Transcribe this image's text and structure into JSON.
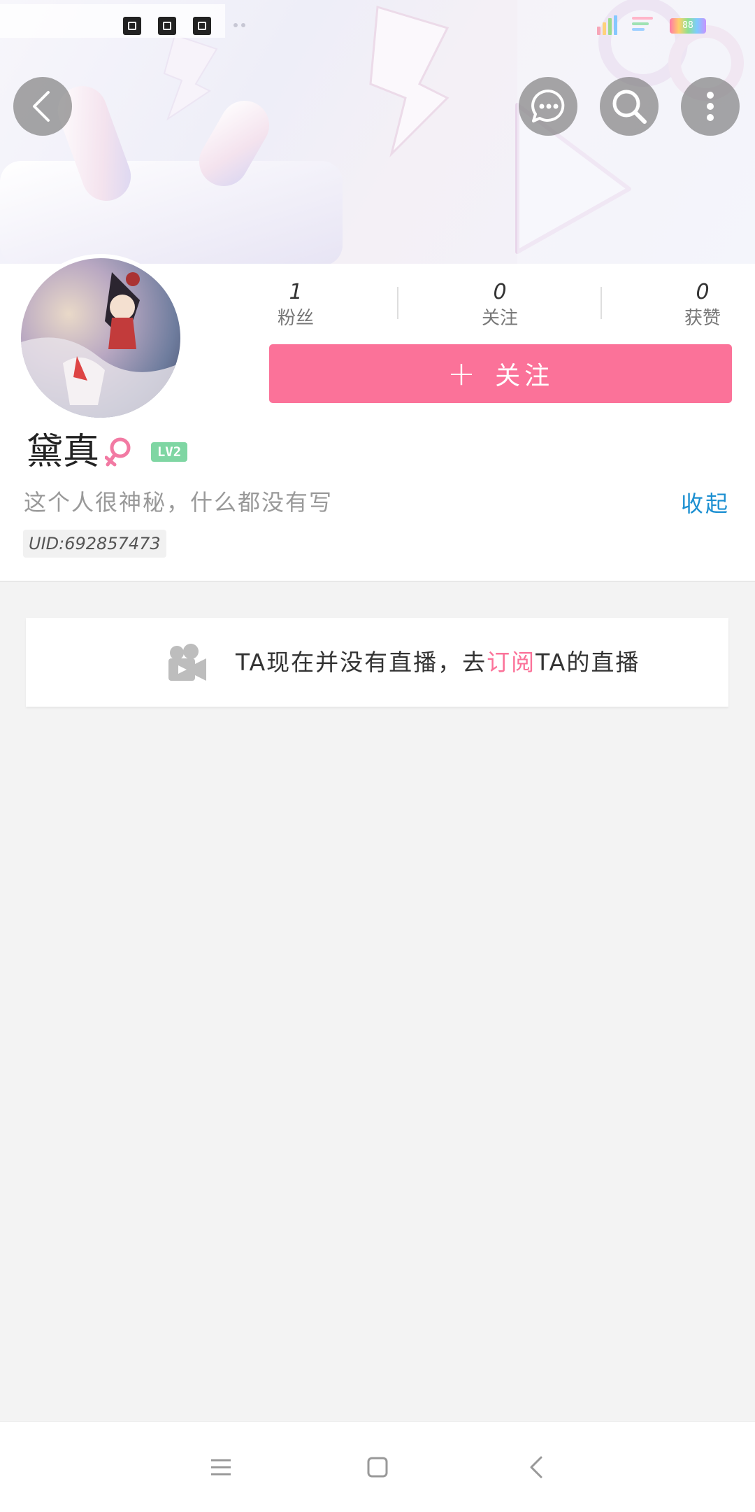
{
  "status_bar": {
    "battery_text": "88",
    "icons": [
      "app-icon-1",
      "edit-icon",
      "app-icon-3"
    ]
  },
  "header": {
    "back_icon": "chevron-left-icon",
    "actions": [
      "message-icon",
      "search-icon",
      "more-vertical-icon"
    ]
  },
  "profile": {
    "username": "黛真",
    "gender": "female",
    "level": "LV2",
    "signature": "这个人很神秘，什么都没有写",
    "collapse_label": "收起",
    "uid": "UID:692857473",
    "stats": [
      {
        "value": "1",
        "label": "粉丝"
      },
      {
        "value": "0",
        "label": "关注"
      },
      {
        "value": "0",
        "label": "获赞"
      }
    ],
    "follow_button": {
      "plus": "+",
      "label": "关注"
    }
  },
  "live_card": {
    "text_before": "TA现在并没有直播，去",
    "link_text": "订阅",
    "text_after": "TA的直播"
  },
  "colors": {
    "accent_pink": "#fb7299",
    "link_blue": "#1b8fd1",
    "level_green": "#7fd6a3",
    "page_bg": "#f3f3f3"
  },
  "navbar": [
    "menu-icon",
    "home-icon",
    "back-icon"
  ]
}
